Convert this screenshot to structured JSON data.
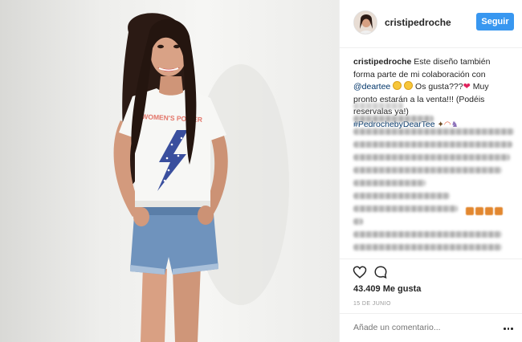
{
  "post": {
    "username": "cristipedroche",
    "follow_label": "Seguir",
    "caption": {
      "user": "cristipedroche",
      "text_1": " Este diseño también forma parte de mi colaboración con ",
      "mention": "@deartee",
      "text_2": " Os gusta???",
      "text_3": " Muy pronto estarán a la venta!!! (Podéis reservalas ya!)",
      "hashtag": "#PedrochebyDearTee"
    },
    "shirt_text": "WOMEN'S POWER",
    "likes": "43.409 Me gusta",
    "date": "15 DE JUNIO",
    "comment_placeholder": "Añade un comentario...",
    "icons": {
      "like": "heart-outline-icon",
      "comment": "speech-bubble-icon",
      "more": "ellipsis-icon"
    },
    "colors": {
      "follow_button": "#3897f0",
      "link": "#003569",
      "text": "#262626",
      "muted": "#999999"
    }
  }
}
